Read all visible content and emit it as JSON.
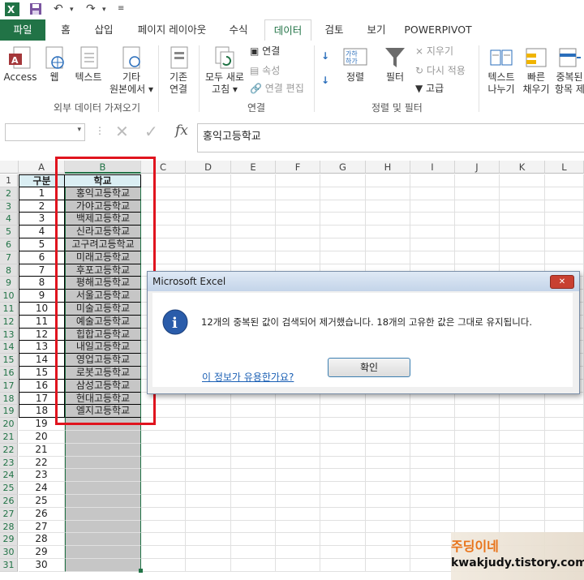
{
  "colors": {
    "brand": "#217346",
    "highlight_border": "#e0141e",
    "selected_fill": "#c6c6c6",
    "link": "#1a5fb4"
  },
  "quick_access": {
    "app_icon": "excel-icon",
    "save_icon": "save-icon",
    "undo_icon": "undo-icon",
    "redo_icon": "redo-icon",
    "customize_icon": "customize-icon"
  },
  "tabs": [
    "파일",
    "홈",
    "삽입",
    "페이지 레이아웃",
    "수식",
    "데이터",
    "검토",
    "보기",
    "POWERPIVOT"
  ],
  "ribbon": {
    "external": {
      "access": "Access",
      "web": "웹",
      "text": "텍스트",
      "other_1": "기타",
      "other_2": "원본에서 ▾",
      "label": "외부 데이터 가져오기"
    },
    "existing": {
      "line1": "기존",
      "line2": "연결"
    },
    "connections": {
      "refresh_1": "모두 새로",
      "refresh_2": "고침 ▾",
      "connect": "연결",
      "props": "속성",
      "edit": "연결 편집",
      "label": "연결"
    },
    "sort": {
      "sort": "정렬",
      "filter": "필터",
      "clear": "지우기",
      "reapply": "다시 적용",
      "advanced": "고급",
      "label": "정렬 및 필터"
    },
    "tools": {
      "ttc_1": "텍스트",
      "ttc_2": "나누기",
      "flash_1": "빠른",
      "flash_2": "채우기",
      "dup_1": "중복된",
      "dup_2": "항목 제"
    }
  },
  "formula_bar": {
    "name_box": "",
    "fx": "fx",
    "content": "홍익고등학교"
  },
  "columns": [
    "A",
    "B",
    "C",
    "D",
    "E",
    "F",
    "G",
    "H",
    "I",
    "J",
    "K",
    "L"
  ],
  "header_row": {
    "a": "구분",
    "b": "학교"
  },
  "rows_a": [
    "1",
    "2",
    "3",
    "4",
    "5",
    "6",
    "7",
    "8",
    "9",
    "10",
    "11",
    "12",
    "13",
    "14",
    "15",
    "16",
    "17",
    "18",
    "19",
    "20",
    "21",
    "22",
    "23",
    "24",
    "25",
    "26",
    "27",
    "28",
    "29",
    "30"
  ],
  "rows_b": [
    "홍익고등학교",
    "가야고등학교",
    "백제고등학교",
    "신라고등학교",
    "고구려고등학교",
    "미래고등학교",
    "후포고등학교",
    "평해고등학교",
    "서울고등학교",
    "미술고등학교",
    "예술고등학교",
    "힙합고등학교",
    "내일고등학교",
    "영업고등학교",
    "로봇고등학교",
    "삼성고등학교",
    "현대고등학교",
    "엘지고등학교"
  ],
  "row_numbers": [
    "1",
    "2",
    "3",
    "4",
    "5",
    "6",
    "7",
    "8",
    "9",
    "10",
    "11",
    "12",
    "13",
    "14",
    "15",
    "16",
    "17",
    "18",
    "19",
    "20",
    "21",
    "22",
    "23",
    "24",
    "25",
    "26",
    "27",
    "28",
    "29",
    "30",
    "31"
  ],
  "dialog": {
    "title": "Microsoft Excel",
    "message": "12개의 중복된 값이 검색되어 제거했습니다. 18개의 고유한 값은 그대로 유지됩니다.",
    "ok": "확인",
    "help_link": "이 정보가 유용한가요?"
  },
  "watermark": {
    "line1": "주딩이네",
    "line2": "kwakjudy.tistory.com"
  }
}
